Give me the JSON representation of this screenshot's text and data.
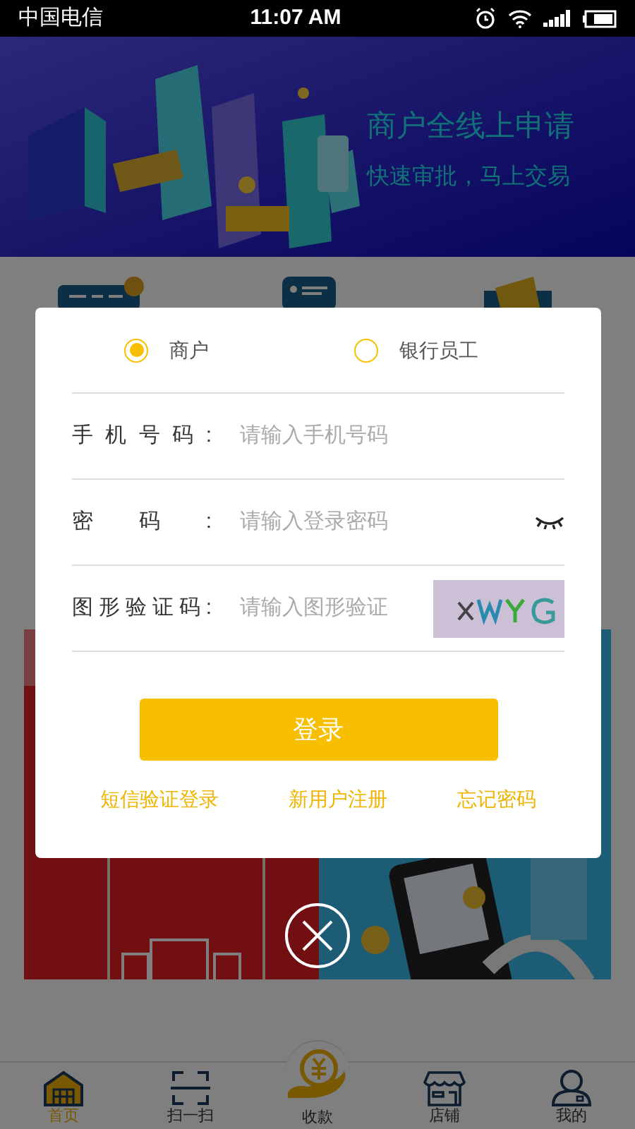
{
  "status_bar": {
    "carrier": "中国电信",
    "time": "11:07 AM"
  },
  "banner": {
    "title": "商户全线上申请",
    "subtitle": "快速审批，马上交易"
  },
  "login_dialog": {
    "roles": [
      {
        "label": "商户",
        "selected": true
      },
      {
        "label": "银行员工",
        "selected": false
      }
    ],
    "fields": [
      {
        "kind": "text",
        "label": "手机号码:",
        "placeholder": "请输入手机号码"
      },
      {
        "kind": "password",
        "label": "密码:",
        "placeholder": "请输入登录密码"
      },
      {
        "kind": "captcha",
        "label": "图形验证码:",
        "placeholder": "请输入图形验证"
      }
    ],
    "button": "登录",
    "links": [
      "短信验证登录",
      "新用户注册",
      "忘记密码"
    ]
  },
  "bottom_nav": {
    "items": [
      {
        "kind": "home",
        "label": "首页",
        "selected": true
      },
      {
        "kind": "scan",
        "label": "扫一扫",
        "selected": false
      },
      {
        "kind": "collect",
        "label": "收款",
        "selected": false
      },
      {
        "kind": "shop",
        "label": "店铺",
        "selected": false
      },
      {
        "kind": "profile",
        "label": "我的",
        "selected": false
      }
    ]
  }
}
